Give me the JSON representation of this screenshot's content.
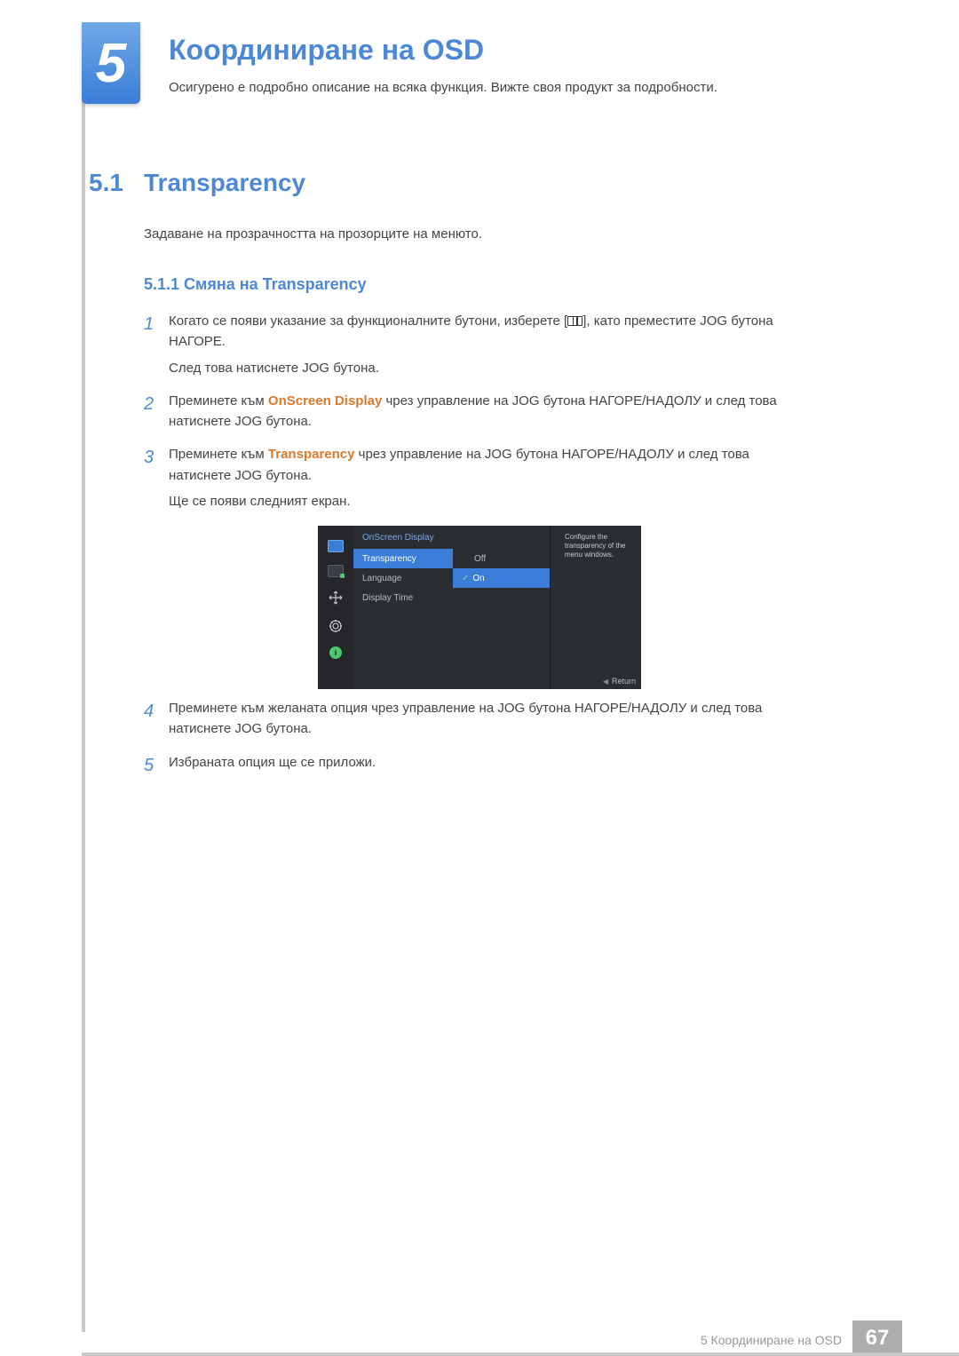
{
  "chapter": {
    "number": "5",
    "title": "Координиране на OSD",
    "description": "Осигурено е подробно описание на всяка функция. Вижте своя продукт за подробности."
  },
  "section": {
    "number": "5.1",
    "title": "Transparency",
    "description": "Задаване на прозрачността на прозорците на менюто."
  },
  "subsection": {
    "number": "5.1.1",
    "title": "Смяна на Transparency",
    "label": "5.1.1   Смяна на Transparency"
  },
  "steps": {
    "s1": {
      "num": "1",
      "t1_a": "Когато се появи указание за функционалните бутони, изберете [",
      "t1_b": "], като преместите JOG бутона НАГОРЕ.",
      "t2": "След това натиснете JOG бутона."
    },
    "s2": {
      "num": "2",
      "t_a": "Преминете към ",
      "hl": "OnScreen Display",
      "t_b": " чрез управление на JOG бутона НАГОРЕ/НАДОЛУ и след това натиснете JOG бутона."
    },
    "s3": {
      "num": "3",
      "t_a": "Преминете към ",
      "hl": "Transparency",
      "t_b": " чрез управление на JOG бутона НАГОРЕ/НАДОЛУ и след това натиснете JOG бутона.",
      "t2": "Ще се появи следният екран."
    },
    "s4": {
      "num": "4",
      "t": "Преминете към желаната опция чрез управление на JOG бутона НАГОРЕ/НАДОЛУ и след това натиснете JOG бутона."
    },
    "s5": {
      "num": "5",
      "t": "Избраната опция ще се приложи."
    }
  },
  "osd": {
    "header": "OnScreen Display",
    "menu": {
      "transparency": "Transparency",
      "language": "Language",
      "display_time": "Display Time"
    },
    "options": {
      "off": "Off",
      "on": "On"
    },
    "help": "Configure the transparency of the menu windows.",
    "return": "Return",
    "info_glyph": "i"
  },
  "footer": {
    "label": "5 Координиране на OSD",
    "page": "67"
  }
}
